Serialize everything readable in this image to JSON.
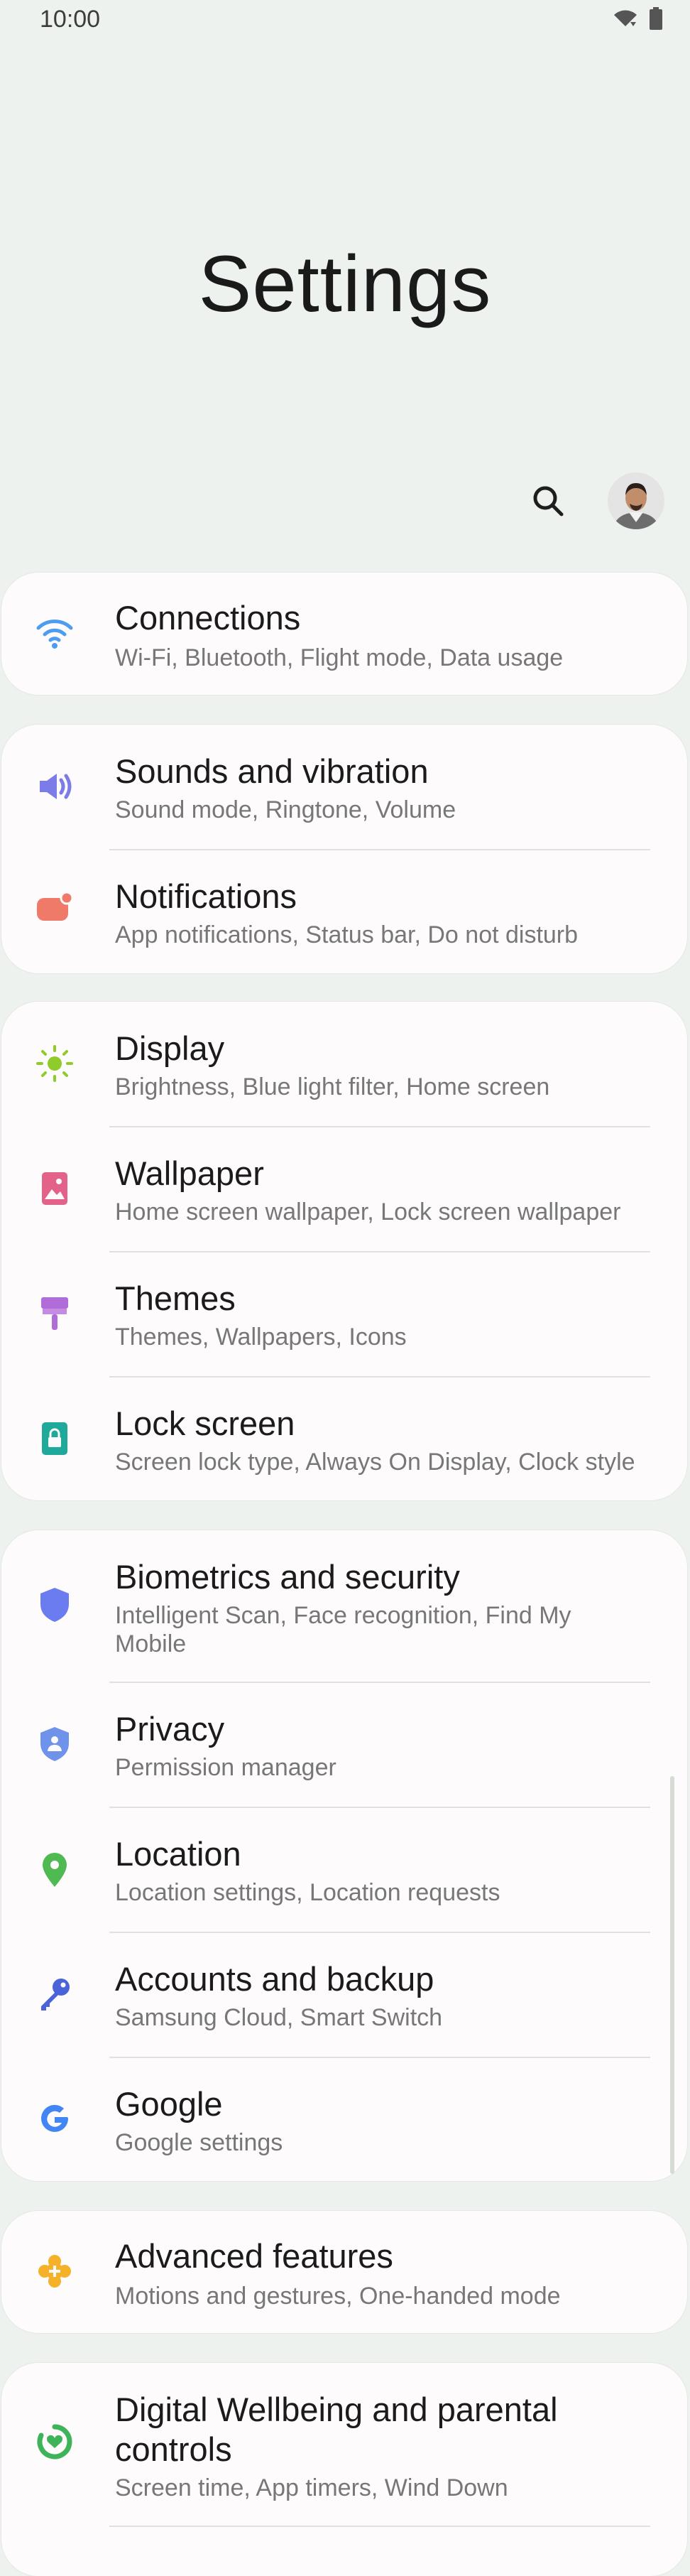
{
  "status": {
    "time": "10:00"
  },
  "header": {
    "title": "Settings"
  },
  "colors": {
    "background": "#eef2ee",
    "card": "#fdfbfc"
  },
  "items": [
    {
      "title": "Connections",
      "subtitle": "Wi-Fi, Bluetooth, Flight mode, Data usage",
      "icon": "wifi-icon",
      "color": "#4e9bf2"
    },
    {
      "title": "Sounds and vibration",
      "subtitle": "Sound mode, Ringtone, Volume",
      "icon": "volume-icon",
      "color": "#7c7ce8"
    },
    {
      "title": "Notifications",
      "subtitle": "App notifications, Status bar, Do not disturb",
      "icon": "notification-icon",
      "color": "#ef7a6a"
    },
    {
      "title": "Display",
      "subtitle": "Brightness, Blue light filter, Home screen",
      "icon": "sun-icon",
      "color": "#8fcc2a"
    },
    {
      "title": "Wallpaper",
      "subtitle": "Home screen wallpaper, Lock screen wallpaper",
      "icon": "image-icon",
      "color": "#e2628a"
    },
    {
      "title": "Themes",
      "subtitle": "Themes, Wallpapers, Icons",
      "icon": "paintbrush-icon",
      "color": "#b06cd8"
    },
    {
      "title": "Lock screen",
      "subtitle": "Screen lock type, Always On Display, Clock style",
      "icon": "lock-icon",
      "color": "#1fa99a"
    },
    {
      "title": "Biometrics and security",
      "subtitle": "Intelligent Scan, Face recognition, Find My Mobile",
      "icon": "shield-icon",
      "color": "#6b7cf0"
    },
    {
      "title": "Privacy",
      "subtitle": "Permission manager",
      "icon": "privacy-shield-icon",
      "color": "#6f93ea"
    },
    {
      "title": "Location",
      "subtitle": "Location settings, Location requests",
      "icon": "location-pin-icon",
      "color": "#4fba52"
    },
    {
      "title": "Accounts and backup",
      "subtitle": "Samsung Cloud, Smart Switch",
      "icon": "key-icon",
      "color": "#4a63d8"
    },
    {
      "title": "Google",
      "subtitle": "Google settings",
      "icon": "google-icon",
      "color": "#4285f4"
    },
    {
      "title": "Advanced features",
      "subtitle": "Motions and gestures, One-handed mode",
      "icon": "puzzle-gear-icon",
      "color": "#f5b12a"
    },
    {
      "title": "Digital Wellbeing and parental controls",
      "subtitle": "Screen time, App timers, Wind Down",
      "icon": "wellbeing-icon",
      "color": "#3fb35a"
    }
  ]
}
